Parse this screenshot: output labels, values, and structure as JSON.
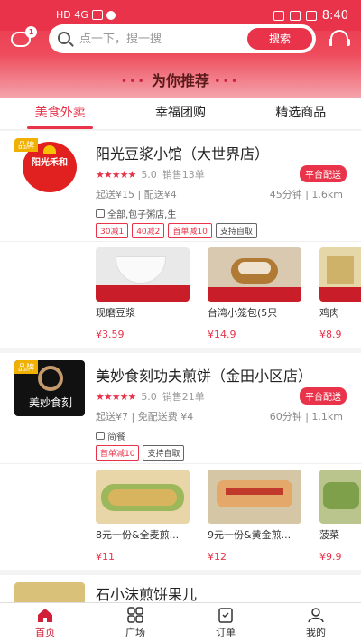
{
  "status_bar": {
    "left_text": "HD 4G",
    "time": "8:40"
  },
  "header": {
    "message_badge": "1",
    "search_placeholder": "点一下，搜一搜",
    "search_button": "搜索",
    "recommend_title": "为你推荐"
  },
  "tabs": [
    {
      "label": "美食外卖",
      "active": true
    },
    {
      "label": "幸福团购",
      "active": false
    },
    {
      "label": "精选商品",
      "active": false
    }
  ],
  "stores": [
    {
      "brand_tag": "品牌",
      "logo_text": "阳光禾和",
      "name": "阳光豆浆小馆（大世界店）",
      "stars": "★★★★★",
      "rating": "5.0",
      "sales": "销售13单",
      "delivery_tag": "平台配送",
      "info": "起送¥15 | 配送¥4",
      "distance": "45分钟 | 1.6km",
      "categories": "全部,包子粥店,生",
      "promos": [
        "30减1",
        "40减2",
        "首单减10",
        "支持自取"
      ],
      "products": [
        {
          "name": "现磨豆浆",
          "price": "¥3.59"
        },
        {
          "name": "台湾小笼包(5只",
          "price": "¥14.9"
        },
        {
          "name": "鸡肉",
          "price": "¥8.9"
        }
      ]
    },
    {
      "brand_tag": "品牌",
      "logo_text": "美妙食刻",
      "name": "美妙食刻功夫煎饼（金田小区店）",
      "stars": "★★★★★",
      "rating": "5.0",
      "sales": "销售21单",
      "delivery_tag": "平台配送",
      "info": "起送¥7 | 免配送费 ¥4",
      "distance": "60分钟 | 1.1km",
      "categories": "简餐",
      "promos": [
        "首单减10",
        "支持自取"
      ],
      "products": [
        {
          "name": "8元一份&全麦煎...",
          "price": "¥11"
        },
        {
          "name": "9元一份&黄金煎...",
          "price": "¥12"
        },
        {
          "name": "菠菜",
          "price": "¥9.9"
        }
      ]
    },
    {
      "name": "石小沫煎饼果儿"
    }
  ],
  "bottom_nav": [
    {
      "label": "首页",
      "icon": "home-icon",
      "active": true
    },
    {
      "label": "广场",
      "icon": "grid-icon",
      "active": false
    },
    {
      "label": "订单",
      "icon": "order-icon",
      "active": false
    },
    {
      "label": "我的",
      "icon": "user-icon",
      "active": false
    }
  ],
  "colors": {
    "accent": "#e8334a",
    "star": "#e8334a",
    "brand_tag": "#f0b000"
  }
}
